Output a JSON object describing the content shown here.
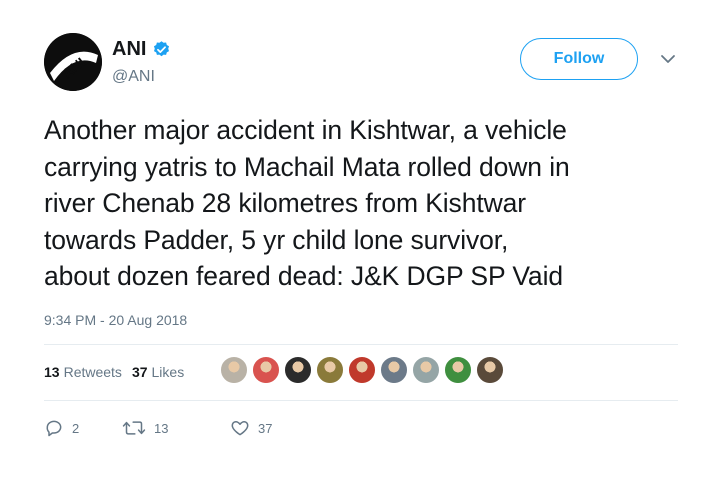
{
  "account": {
    "name": "ANI",
    "handle": "@ANI",
    "avatar_text": "ANI"
  },
  "follow_label": "Follow",
  "tweet_lines": [
    "Another major accident in Kishtwar, a vehicle",
    "carrying yatris to Machail Mata rolled down in",
    "river Chenab 28 kilometres from Kishtwar",
    "towards Padder, 5 yr child lone survivor,",
    "about dozen feared dead: J&K DGP SP Vaid"
  ],
  "timestamp": "9:34 PM - 20 Aug 2018",
  "stats": {
    "retweets_count": "13",
    "retweets_label": "Retweets",
    "likes_count": "37",
    "likes_label": "Likes"
  },
  "likers": [
    {
      "color": "#b9b2a6"
    },
    {
      "color": "#d9534f"
    },
    {
      "color": "#2b2b2b"
    },
    {
      "color": "#8a7a3a"
    },
    {
      "color": "#c0392b"
    },
    {
      "color": "#6c7a89"
    },
    {
      "color": "#95a5a6"
    },
    {
      "color": "#3f8f3f"
    },
    {
      "color": "#5a4a3a"
    }
  ],
  "actions": {
    "reply_count": "2",
    "retweet_count": "13",
    "like_count": "37"
  },
  "colors": {
    "brand_blue": "#1da1f2",
    "muted": "#657786",
    "text": "#14171a"
  }
}
